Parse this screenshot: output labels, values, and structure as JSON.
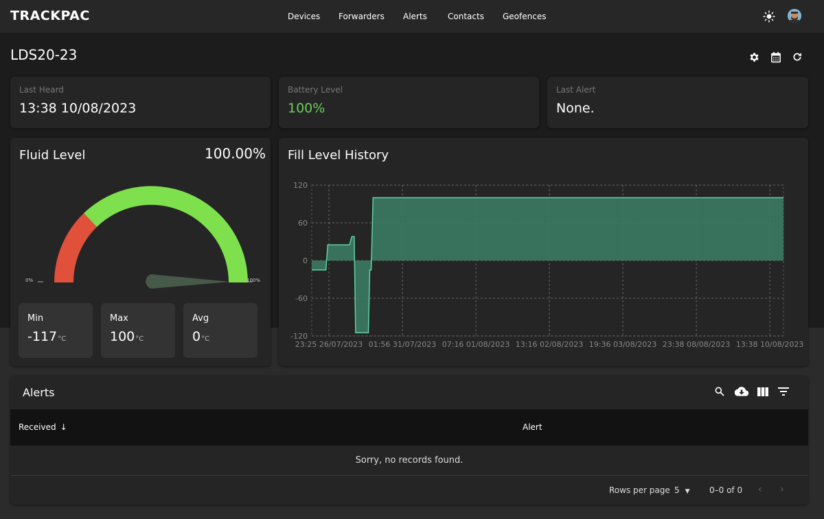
{
  "app": {
    "brand": "TRACKPAC"
  },
  "nav": {
    "items": [
      "Devices",
      "Forwarders",
      "Alerts",
      "Contacts",
      "Geofences"
    ]
  },
  "header_icons": {
    "theme": "sun-icon",
    "user": "avatar"
  },
  "page": {
    "title": "LDS20-23"
  },
  "toolbar_icons": [
    "gear-icon",
    "calendar-icon",
    "refresh-icon"
  ],
  "stats": {
    "last_heard_label": "Last Heard",
    "last_heard_value": "13:38 10/08/2023",
    "battery_label": "Battery Level",
    "battery_value": "100%",
    "last_alert_label": "Last Alert",
    "last_alert_value": "None."
  },
  "colors": {
    "battery_green": "#6bd05b",
    "gauge_green": "#7ee04d",
    "gauge_red": "#e0503a",
    "chart_fill": "#3b7a63",
    "chart_line": "#5fd3a6"
  },
  "fluid": {
    "title": "Fluid Level",
    "value_text": "100.00%",
    "level": 1.0,
    "min_tick": "0%",
    "max_tick": "100%",
    "min_label": "Min",
    "min_value": "-117",
    "min_unit": "°C",
    "max_label": "Max",
    "max_value": "100",
    "max_unit": "°C",
    "avg_label": "Avg",
    "avg_value": "0",
    "avg_unit": "°C"
  },
  "history": {
    "title": "Fill Level History",
    "chart_data": {
      "type": "area",
      "title": "Fill Level History",
      "ylim": [
        -120,
        120
      ],
      "yticks": [
        "120",
        "60",
        "0",
        "-60",
        "-120"
      ],
      "xticks": [
        "23:25 26/07/2023",
        "01:56 31/07/2023",
        "07:16 01/08/2023",
        "13:16 02/08/2023",
        "19:36 03/08/2023",
        "23:38 08/08/2023",
        "13:38 10/08/2023"
      ],
      "series": [
        {
          "values": [
            [
              0,
              -15
            ],
            [
              0.03,
              -15
            ],
            [
              0.034,
              25
            ],
            [
              0.08,
              25
            ],
            [
              0.085,
              38
            ],
            [
              0.09,
              38
            ],
            [
              0.093,
              -115
            ],
            [
              0.12,
              -115
            ],
            [
              0.123,
              -15
            ],
            [
              0.126,
              -15
            ],
            [
              0.13,
              100
            ],
            [
              1.0,
              100
            ]
          ]
        }
      ],
      "grid": true
    }
  },
  "alerts": {
    "title": "Alerts",
    "icons": [
      "search-icon",
      "cloud-download-icon",
      "view-column-icon",
      "filter-icon"
    ],
    "col_received": "Received",
    "col_alert": "Alert",
    "empty": "Sorry, no records found.",
    "rows_per_page_label": "Rows per page",
    "rows_per_page_value": "5",
    "range": "0–0 of 0"
  }
}
